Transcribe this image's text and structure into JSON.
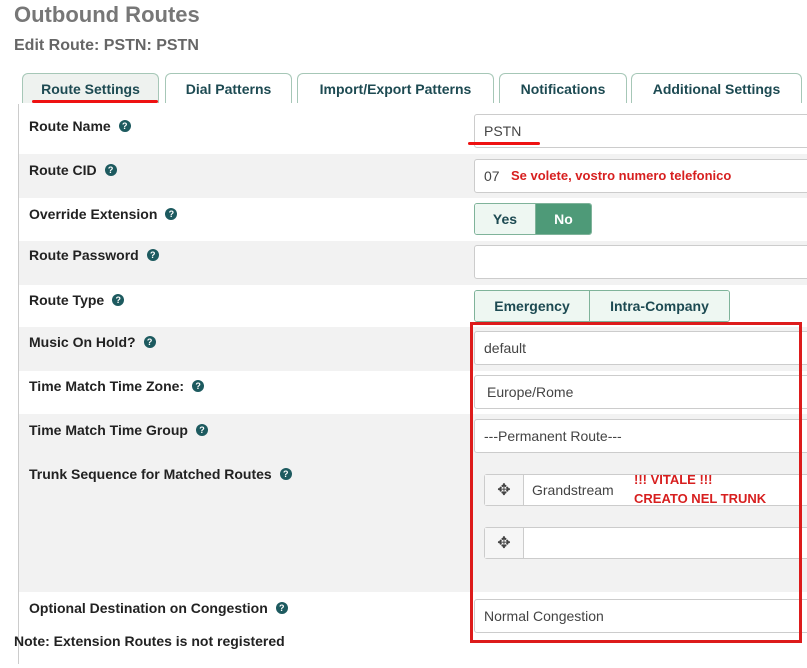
{
  "header": {
    "title": "Outbound Routes",
    "subtitle": "Edit Route: PSTN: PSTN"
  },
  "tabs": [
    {
      "label": "Route Settings"
    },
    {
      "label": "Dial Patterns"
    },
    {
      "label": "Import/Export Patterns"
    },
    {
      "label": "Notifications"
    },
    {
      "label": "Additional Settings"
    }
  ],
  "form": {
    "route_name": {
      "label": "Route Name",
      "value": "PSTN"
    },
    "route_cid": {
      "label": "Route CID",
      "value": "07",
      "annotation": "Se volete, vostro numero telefonico"
    },
    "override_extension": {
      "label": "Override Extension",
      "yes": "Yes",
      "no": "No",
      "selected": "No"
    },
    "route_password": {
      "label": "Route Password",
      "value": ""
    },
    "route_type": {
      "label": "Route Type",
      "emergency": "Emergency",
      "intra_company": "Intra-Company"
    },
    "music_on_hold": {
      "label": "Music On Hold?",
      "value": "default"
    },
    "time_zone": {
      "label": "Time Match Time Zone:",
      "value": "Europe/Rome"
    },
    "time_group": {
      "label": "Time Match Time Group",
      "value": "---Permanent Route---"
    },
    "trunk_sequence": {
      "label": "Trunk Sequence for Matched Routes",
      "trunks": [
        "Grandstream",
        ""
      ],
      "annotation_line1": "!!! VITALE !!!",
      "annotation_line2": "CREATO NEL TRUNK"
    },
    "congestion": {
      "label": "Optional Destination on Congestion",
      "value": "Normal Congestion"
    }
  },
  "note": "Note: Extension Routes is not registered",
  "colors": {
    "accent": "#4e9a78",
    "annotation": "#d71f1f"
  }
}
